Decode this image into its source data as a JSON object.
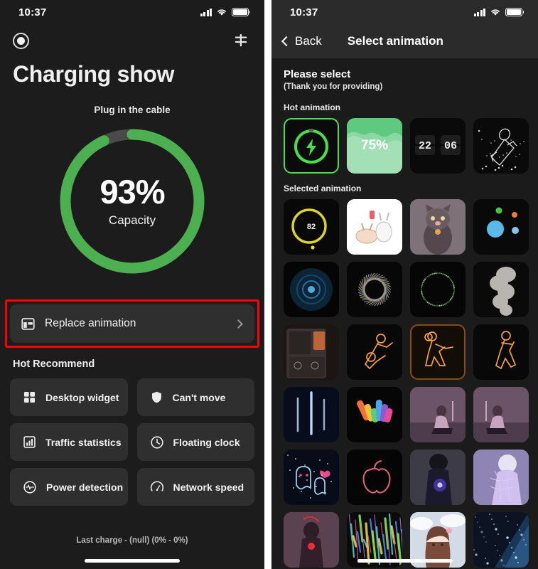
{
  "left": {
    "status": {
      "time": "10:37",
      "signal_icon": "cellular-signal-icon",
      "wifi_icon": "wifi-icon",
      "battery_icon": "battery-icon"
    },
    "topbar": {
      "record_icon": "record-dot-icon",
      "filter_icon": "filter-sliders-icon"
    },
    "title": "Charging show",
    "subtitle": "Plug in the cable",
    "ring": {
      "percent_label": "93%",
      "caption": "Capacity",
      "value": 93,
      "track_color": "#4caf50",
      "rest_color": "#4a4a4a"
    },
    "replace": {
      "icon": "layout-panel-icon",
      "label": "Replace animation",
      "chevron_icon": "chevron-right-icon",
      "highlight_color": "#fe0000"
    },
    "hot_recommend_heading": "Hot Recommend",
    "tiles": [
      {
        "icon": "grid-squares-icon",
        "label": "Desktop widget"
      },
      {
        "icon": "shield-icon",
        "label": "Can't move"
      },
      {
        "icon": "bar-chart-icon",
        "label": "Traffic statistics"
      },
      {
        "icon": "clock-icon",
        "label": "Floating clock"
      },
      {
        "icon": "power-pulse-icon",
        "label": "Power detection"
      },
      {
        "icon": "speedometer-icon",
        "label": "Network speed"
      }
    ],
    "last_charge": "Last charge  -  (null) (0% - 0%)"
  },
  "right": {
    "status": {
      "time": "10:37",
      "signal_icon": "cellular-signal-icon",
      "wifi_icon": "wifi-icon",
      "battery_icon": "battery-icon"
    },
    "navbar": {
      "back_icon": "chevron-left-icon",
      "back_label": "Back",
      "title": "Select animation"
    },
    "please_select": "Please select",
    "thanks_note": "(Thank you for providing)",
    "hot_animation_heading": "Hot animation",
    "selected_animation_heading": "Selected animation",
    "hot_items": [
      {
        "name": "green-charging-ring-thumb",
        "selected": true,
        "bg": "#0b0b0b",
        "accent": "#4ade4a",
        "text": ""
      },
      {
        "name": "green-mountain-percent-thumb",
        "selected": false,
        "bg": "#5ec97f",
        "accent": "#ffffff",
        "text": "75%"
      },
      {
        "name": "flip-clock-thumb",
        "selected": false,
        "bg": "#0a0a0a",
        "accent": "#e8e8e8",
        "text": "22 06"
      },
      {
        "name": "rocket-line-art-thumb",
        "selected": false,
        "bg": "#0a0a0a",
        "accent": "#dcdcdc",
        "text": ""
      }
    ],
    "selected_items": [
      {
        "name": "yellow-ring-battery-thumb",
        "bg": "#080808",
        "accent": "#ece01f",
        "text": "82"
      },
      {
        "name": "cartoon-bunnies-thumb",
        "bg": "#fdfdfd",
        "accent": "#d9b7a0",
        "text": ""
      },
      {
        "name": "grey-cat-thumb",
        "bg": "#7e7278",
        "accent": "#4a4045",
        "text": ""
      },
      {
        "name": "planets-dots-thumb",
        "bg": "#090909",
        "accent": "#5bb9ea",
        "text": ""
      },
      {
        "name": "blue-vinyl-circle-thumb",
        "bg": "#050505",
        "accent": "#17466b",
        "text": ""
      },
      {
        "name": "iridescent-donut-thumb",
        "bg": "#070707",
        "accent": "#b98c6a",
        "text": ""
      },
      {
        "name": "dotted-ring-thumb",
        "bg": "#060606",
        "accent": "#9de08b",
        "text": ""
      },
      {
        "name": "smoke-plume-thumb",
        "bg": "#0a0a0a",
        "accent": "#d7d4ce",
        "text": ""
      },
      {
        "name": "iphone-teardown-battery-thumb",
        "bg": "#2a2222",
        "accent": "#e8743a",
        "text": ""
      },
      {
        "name": "neon-soccer-player-thumb",
        "bg": "#080808",
        "accent": "#f7a03c",
        "text": ""
      },
      {
        "name": "neon-basketball-player-thumb",
        "bg": "#120d07",
        "accent": "#f7a03c",
        "text": "",
        "highlighted": true
      },
      {
        "name": "neon-golf-player-thumb",
        "bg": "#080808",
        "accent": "#f7a03c",
        "text": ""
      },
      {
        "name": "blue-light-beams-thumb",
        "bg": "#070d1c",
        "accent": "#bcd8f5",
        "text": ""
      },
      {
        "name": "rainbow-apple-logo-thumb",
        "bg": "#060606",
        "accent": "#f36f3a",
        "text": ""
      },
      {
        "name": "purple-seated-girl-thumb",
        "bg": "#6b5368",
        "accent": "#cdb4c9",
        "text": ""
      },
      {
        "name": "purple-seated-boy-thumb",
        "bg": "#6b5368",
        "accent": "#cdb4c9",
        "text": ""
      },
      {
        "name": "neon-ghost-couple-thumb",
        "bg": "#080c18",
        "accent": "#9fd7f0",
        "text": ""
      },
      {
        "name": "outline-apple-logo-thumb",
        "bg": "#050505",
        "accent": "#e0637a",
        "text": ""
      },
      {
        "name": "anime-boy-glow-thumb",
        "bg": "#3d3b46",
        "accent": "#5c4bf0",
        "text": ""
      },
      {
        "name": "anime-girl-wire-thumb",
        "bg": "#8e85b4",
        "accent": "#d7c9ff",
        "text": ""
      },
      {
        "name": "red-silhouette-thumb",
        "bg": "#5b4250",
        "accent": "#ef2b3a",
        "text": ""
      },
      {
        "name": "colorful-light-streaks-thumb",
        "bg": "#0b0b0b",
        "accent": "#a86bd8",
        "text": ""
      },
      {
        "name": "anime-girl-clouds-thumb",
        "bg": "#d2dbe6",
        "accent": "#8a5a4a",
        "text": ""
      },
      {
        "name": "starry-night-thumb",
        "bg": "#0c1424",
        "accent": "#6fa8d8",
        "text": ""
      }
    ]
  }
}
